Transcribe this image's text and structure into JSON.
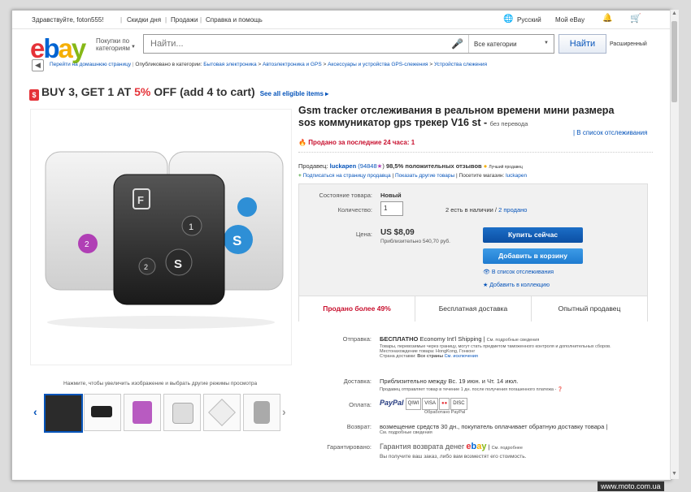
{
  "topbar": {
    "greeting": "Здравствуйте, foton555!",
    "deals": "Скидки дня",
    "sell": "Продажи",
    "help": "Справка и помощь",
    "language": "Русский",
    "my_ebay": "Мой eBay"
  },
  "header": {
    "browse_label": "Покупки по категориям",
    "search_placeholder": "Найти...",
    "category_select": "Все категории",
    "find_button": "Найти",
    "advanced": "Расширенный"
  },
  "breadcrumb": {
    "back": "Перейти на домашнюю страницу",
    "published": "Опубликовано в категории:",
    "items": [
      "Бытовая электроника",
      "Автоэлектроника и GPS",
      "Аксессуары и устройства GPS-слежения",
      "Устройства слежения"
    ]
  },
  "promo": {
    "part1": "BUY 3, GET 1 AT ",
    "percent": "5%",
    "part2": " OFF (add 4 to cart)",
    "see_all": "See all eligible items ▸"
  },
  "gallery": {
    "zoom_hint": "Нажмите, чтобы увеличить изображение и выбрать другие режимы просмотра"
  },
  "product": {
    "title": "Gsm tracker отслеживания в реальном времени мини размера sos коммуникатор gps трекер V16 st -",
    "untranslated": "без перевода",
    "watchlist": "| В список отслеживания",
    "sold_24h": "Продано за последние 24 часа: 1",
    "seller_label": "Продавец:",
    "seller_name": "luckapen",
    "seller_score": "(94848",
    "seller_positive": "98,5% положительных отзывов",
    "top_seller": "Лучший продавец",
    "subscribe": "Подписаться на страницу продавца",
    "other_items": "Показать другие товары",
    "visit_store": "Посетите магазин:",
    "store_name": "luckapen"
  },
  "purchase": {
    "condition_label": "Состояние товара:",
    "condition_value": "Новый",
    "qty_label": "Количество:",
    "qty_value": "1",
    "stock": "2 есть в наличии /",
    "sold": "2 продано",
    "price_label": "Цена:",
    "price": "US $8,09",
    "price_rub": "Приблизительно 540,70 руб.",
    "buy_now": "Купить сейчас",
    "add_to_cart": "Добавить в корзину",
    "add_watch": "В список отслеживания",
    "add_collection": "Добавить в коллекцию",
    "badge_sold": "Продано более 49%",
    "badge_shipping": "Бесплатная доставка",
    "badge_seller": "Опытный продавец"
  },
  "shipping": {
    "ship_label": "Отправка:",
    "ship_value": "БЕСПЛАТНО",
    "ship_method": "Economy Int'l Shipping |",
    "ship_details": "См. подробные сведения",
    "customs": "Товары, перевозимые через границу, могут стать предметом таможенного контроля и дополнительных сборов.",
    "location": "Местонахождение товара: HongKong, Гонконг",
    "country_label": "Страна доставки:",
    "country_value": "Все страны",
    "exclusions": "См. исключения",
    "delivery_label": "Доставка:",
    "delivery_value": "Приблизительно между Вс. 19 июн. и Чт. 14 июл.",
    "delivery_note": "Продавец отправляет товар в течение 1 дн. после получения погашенного платежа -",
    "payment_label": "Оплата:",
    "paypal": "PayPal",
    "processed": "Обработано PayPal",
    "return_label": "Возврат:",
    "return_value": "возмещение средств 30 дн., покупатель оплачивает обратную доставку товара |",
    "return_details": "См. подробные сведения",
    "guarantee_label": "Гарантировано:",
    "guarantee_value": "Гарантия возврата денег",
    "guarantee_details": "См. подробнее",
    "guarantee_note": "Вы получите ваш заказ, либо вам возместят его стоимость."
  },
  "watermark": "www.moto.com.ua",
  "colors": {
    "ebay_red": "#e53238",
    "ebay_blue": "#0064d2",
    "ebay_yellow": "#f5af02",
    "ebay_green": "#86b817",
    "link": "#0654ba"
  }
}
